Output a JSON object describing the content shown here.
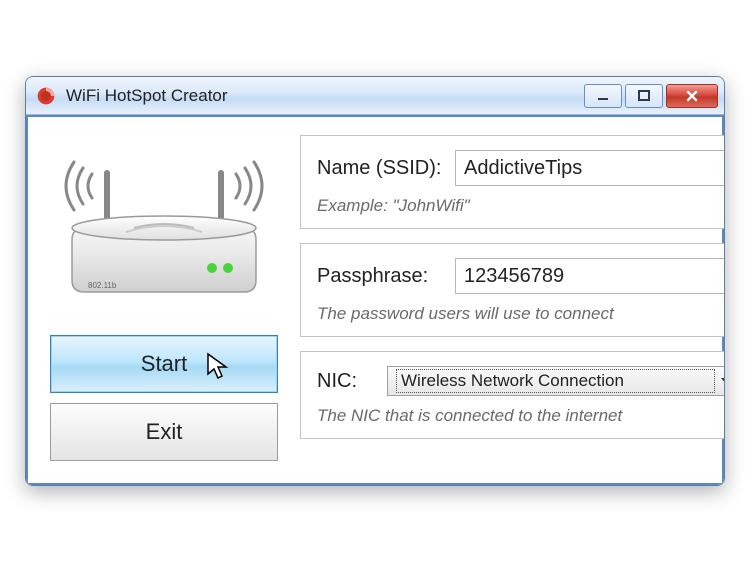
{
  "title": "WiFi HotSpot Creator",
  "buttons": {
    "start": "Start",
    "exit": "Exit"
  },
  "ssid": {
    "label": "Name (SSID):",
    "value": "AddictiveTips",
    "helper": "Example: \"JohnWifi\""
  },
  "passphrase": {
    "label": "Passphrase:",
    "value": "123456789",
    "helper": "The password users will use to connect"
  },
  "nic": {
    "label": "NIC:",
    "selected": "Wireless Network Connection",
    "helper": "The NIC that is connected to the internet"
  }
}
